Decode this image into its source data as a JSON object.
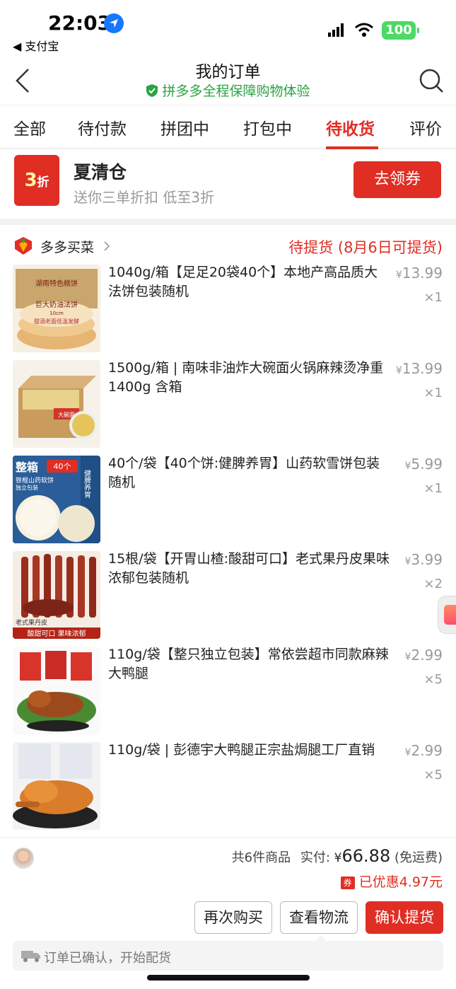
{
  "status_bar": {
    "time": "22:03",
    "back_app": "◀ 支付宝",
    "battery": "100",
    "icons": [
      "location-icon",
      "signal-icon",
      "wifi-icon",
      "battery-icon"
    ]
  },
  "header": {
    "title": "我的订单",
    "subtitle": "拼多多全程保障购物体验"
  },
  "tabs": [
    {
      "label": "全部"
    },
    {
      "label": "待付款"
    },
    {
      "label": "拼团中"
    },
    {
      "label": "打包中"
    },
    {
      "label": "待收货",
      "active": true
    },
    {
      "label": "评价"
    }
  ],
  "promo": {
    "badge_num": "3",
    "badge_unit": "折",
    "title": "夏清仓",
    "subtitle": "送你三单折扣 低至3折",
    "button": "去领券"
  },
  "order": {
    "store_name": "多多买菜",
    "status": "待提货 (8月6日可提货)",
    "items": [
      {
        "name": "1040g/箱【足足20袋40个】本地产高品质大法饼包装随机",
        "price": "13.99",
        "qty": "×1"
      },
      {
        "name": "1500g/箱 | 南味非油炸大碗面火锅麻辣烫净重1400g 含箱",
        "price": "13.99",
        "qty": "×1"
      },
      {
        "name": "40个/袋【40个饼:健脾养胃】山药软雪饼包装随机",
        "price": "5.99",
        "qty": "×1"
      },
      {
        "name": "15根/袋【开胃山楂:酸甜可口】老式果丹皮果味浓郁包装随机",
        "price": "3.99",
        "qty": "×2"
      },
      {
        "name": "110g/袋【整只独立包装】常依尝超市同款麻辣大鸭腿",
        "price": "2.99",
        "qty": "×5"
      },
      {
        "name": "110g/袋 | 彭德宇大鸭腿正宗盐焗腿工厂直销",
        "price": "2.99",
        "qty": "×5"
      }
    ],
    "summary_count": "共6件商品",
    "summary_paid_label": "实付: ",
    "currency": "¥",
    "total": "66.88",
    "shipping": "(免运费)",
    "coupon_tag": "券",
    "discount": "已优惠4.97元",
    "buttons": {
      "rebuy": "再次购买",
      "logistics": "查看物流",
      "confirm": "确认提货"
    },
    "logistics_text": "订单已确认，开始配货"
  },
  "product_image_text": {
    "item1_box": "湖南特色糕饼",
    "item1_label": "巨大奶油法饼",
    "item1_size": "10cm",
    "item1_caption": "甜酒老面低温发酵",
    "item2_box": "大碗面",
    "item3_title": "整箱",
    "item3_count": "40个",
    "item3_sub": "铁棍山药软饼",
    "item3_sub2": "独立包装",
    "item3_side": "健脾养胃",
    "item4_caption": "老式果丹皮",
    "item4_banner": "酸甜可口 果味浓郁"
  },
  "colors": {
    "accent": "#e02e24",
    "green": "#2aa342",
    "muted": "#999999"
  }
}
